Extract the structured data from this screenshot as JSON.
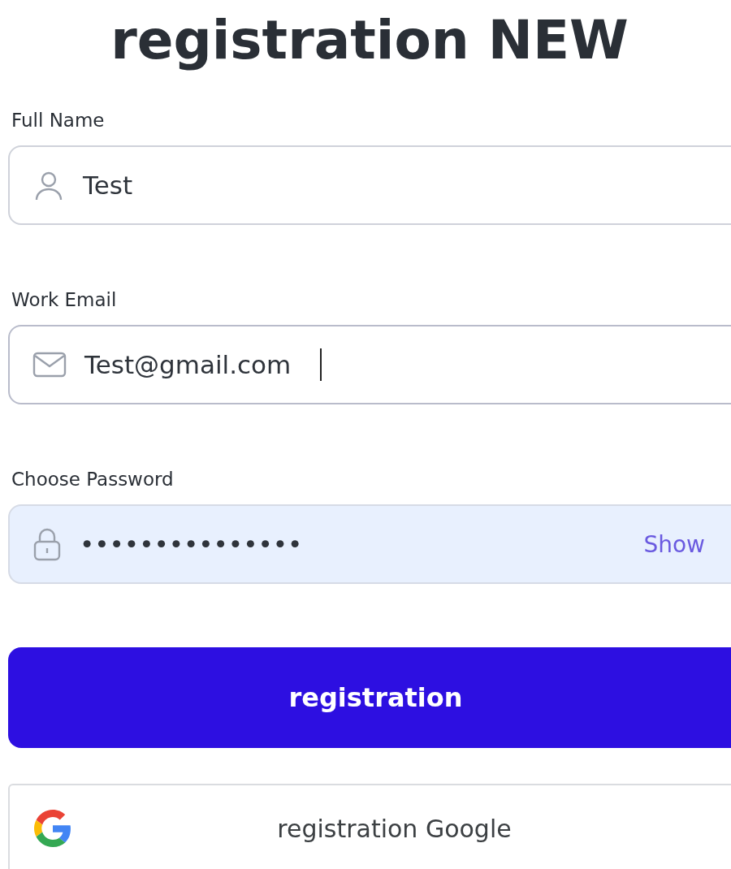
{
  "title": "registration NEW",
  "fields": [
    {
      "kind": "name",
      "label": "Full Name",
      "value": "Test",
      "focused": false
    },
    {
      "kind": "email",
      "label": "Work Email",
      "value": "Test@gmail.com",
      "focused": true
    },
    {
      "kind": "password",
      "label": "Choose Password",
      "value": "•••••••••••••••",
      "focused": false,
      "action": "Show"
    }
  ],
  "submit_button": "registration",
  "google_button": "registration Google"
}
